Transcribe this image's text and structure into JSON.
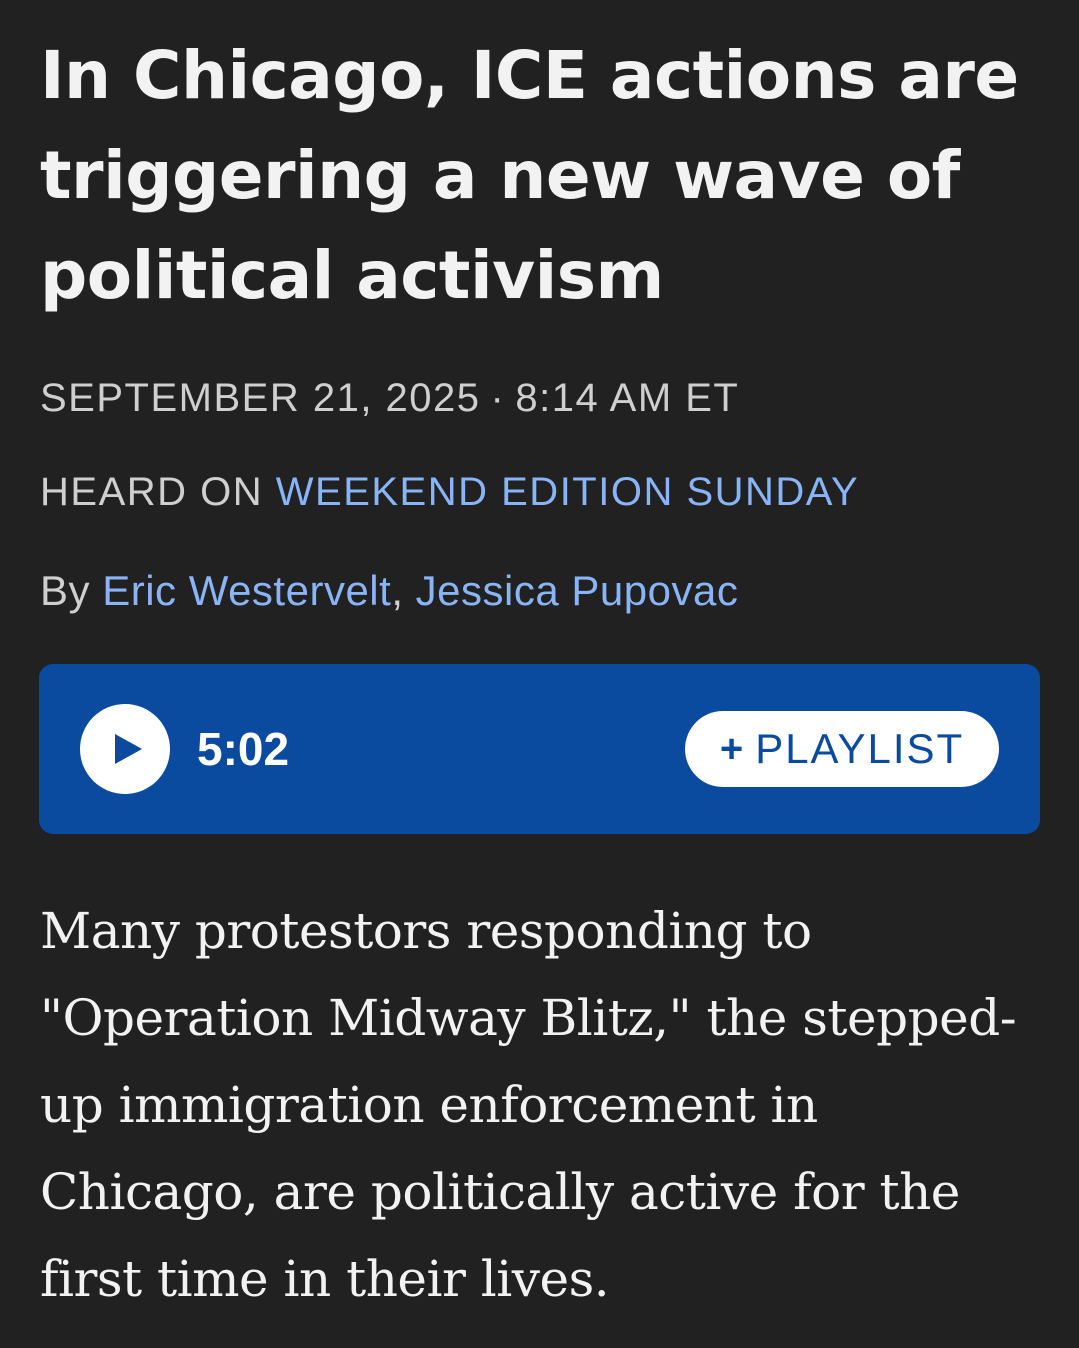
{
  "article": {
    "headline": "In Chicago, ICE actions are triggering a new wave of political activism",
    "date": "SEPTEMBER 21, 2025",
    "separator": "·",
    "time": "8:14 AM ET",
    "heard_on_label": "HEARD ON",
    "program": "WEEKEND EDITION SUNDAY",
    "byline_prefix": "By",
    "authors": [
      "Eric Westervelt",
      "Jessica Pupovac"
    ],
    "author_separator": ",",
    "teaser": "Many protestors responding to \"Operation Midway Blitz,\" the stepped-up immigration enforcement in Chicago, are politically active for the first time in their lives."
  },
  "player": {
    "duration": "5:02",
    "playlist_label": "PLAYLIST",
    "playlist_icon": "+",
    "play_icon": "play-icon"
  },
  "colors": {
    "background": "#212121",
    "link": "#8ab4f8",
    "player_bg": "#0a4ba0"
  }
}
